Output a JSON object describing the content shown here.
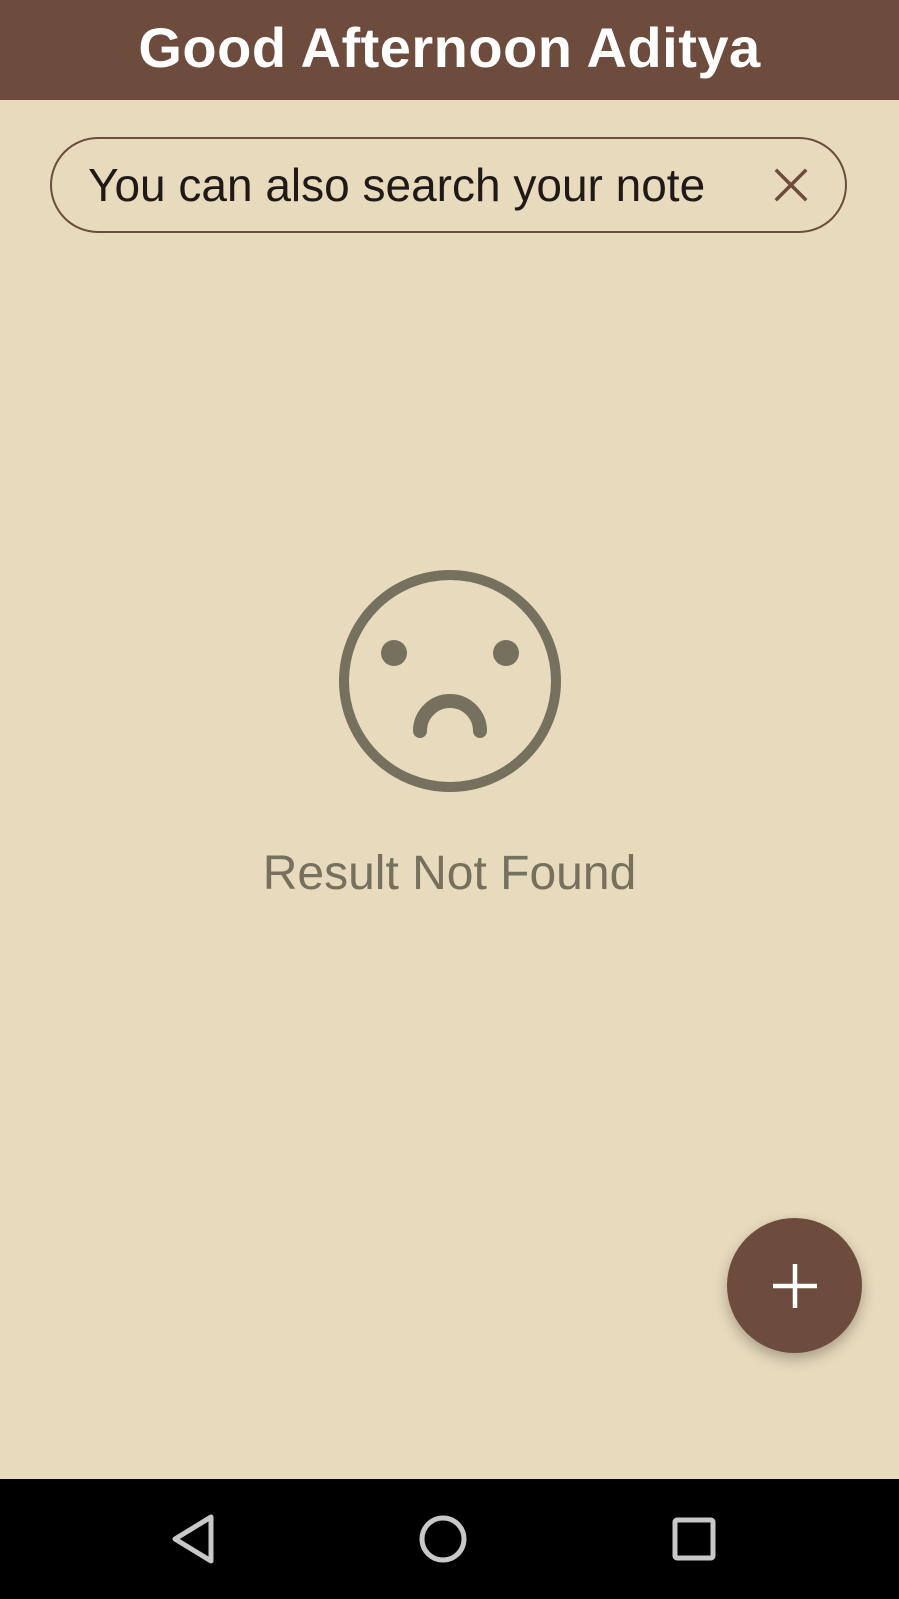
{
  "header": {
    "title": "Good Afternoon Aditya"
  },
  "search": {
    "placeholder": "You can also search your note",
    "value": "",
    "clear_icon": "close-icon"
  },
  "empty_state": {
    "icon": "sad-face-icon",
    "message": "Result Not Found"
  },
  "fab": {
    "icon": "plus-icon"
  },
  "system_nav": {
    "back_icon": "back-triangle-icon",
    "home_icon": "home-circle-icon",
    "recents_icon": "recents-square-icon"
  },
  "colors": {
    "primary": "#6D4C3D",
    "background": "#E8DABD",
    "muted": "#76705F",
    "text": "#1F1A17",
    "nav_bar": "#000000"
  }
}
